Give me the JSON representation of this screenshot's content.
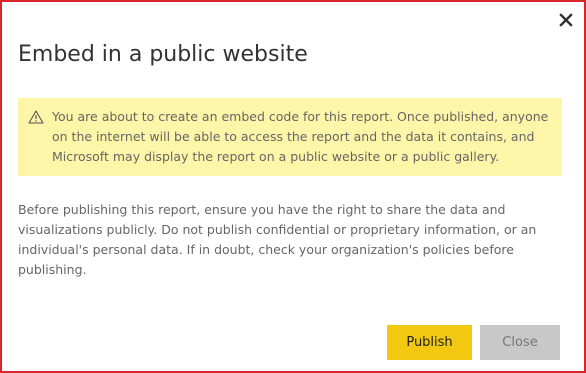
{
  "dialog": {
    "title": "Embed in a public website",
    "close_icon": "close-icon",
    "warning": {
      "icon": "warning-triangle-icon",
      "text": "You are about to create an embed code for this report. Once published, anyone on the internet will be able to access the report and the data it contains, and Microsoft may display the report on a public website or a public gallery."
    },
    "body": "Before publishing this report, ensure you have the right to share the data and visualizations publicly. Do not publish confidential or proprietary information, or an individual's personal data. If in doubt, check your organization's policies before publishing.",
    "buttons": {
      "publish_label": "Publish",
      "close_label": "Close"
    }
  },
  "colors": {
    "accent": "#f2c811",
    "warning_background": "#fdf6a8",
    "border": "#d9262c",
    "disabled_button": "#c8c8c8"
  }
}
